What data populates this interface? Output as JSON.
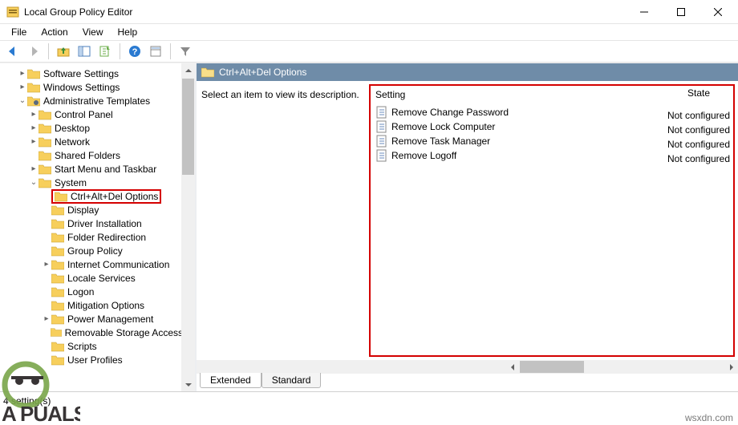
{
  "window": {
    "title": "Local Group Policy Editor"
  },
  "menu": {
    "file": "File",
    "action": "Action",
    "view": "View",
    "help": "Help"
  },
  "tree": {
    "software_settings": "Software Settings",
    "windows_settings": "Windows Settings",
    "admin_templates": "Administrative Templates",
    "control_panel": "Control Panel",
    "desktop": "Desktop",
    "network": "Network",
    "shared_folders": "Shared Folders",
    "start_menu": "Start Menu and Taskbar",
    "system": "System",
    "ctrl_alt_del": "Ctrl+Alt+Del Options",
    "display": "Display",
    "driver_install": "Driver Installation",
    "folder_redirect": "Folder Redirection",
    "group_policy": "Group Policy",
    "internet_comm": "Internet Communication",
    "locale": "Locale Services",
    "logon": "Logon",
    "mitigation": "Mitigation Options",
    "power_mgmt": "Power Management",
    "removable": "Removable Storage Access",
    "scripts": "Scripts",
    "user_profiles": "User Profiles"
  },
  "details": {
    "header": "Ctrl+Alt+Del Options",
    "select_hint": "Select an item to view its description.",
    "col_setting": "Setting",
    "col_state": "State",
    "rows": {
      "r0": {
        "name": "Remove Change Password",
        "state": "Not configured"
      },
      "r1": {
        "name": "Remove Lock Computer",
        "state": "Not configured"
      },
      "r2": {
        "name": "Remove Task Manager",
        "state": "Not configured"
      },
      "r3": {
        "name": "Remove Logoff",
        "state": "Not configured"
      }
    },
    "tabs": {
      "extended": "Extended",
      "standard": "Standard"
    }
  },
  "status": {
    "text": "4 setting(s)"
  },
  "watermark": {
    "text": "wsxdn.com"
  }
}
